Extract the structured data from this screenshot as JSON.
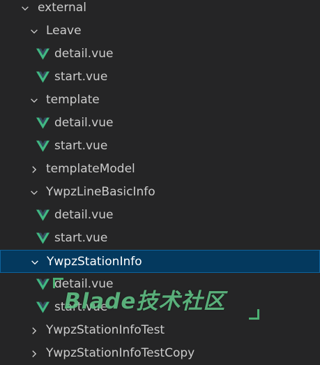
{
  "colors": {
    "background": "#252526",
    "text": "#cccccc",
    "selected_background": "#04395e",
    "selected_border": "#0e639c",
    "vue_green": "#41b883",
    "vue_dark": "#35495e",
    "watermark": "#5fbf84"
  },
  "explorer": {
    "items": [
      {
        "label": "external",
        "type": "folder",
        "expanded": true,
        "icon": "chevron-down-icon"
      },
      {
        "label": "Leave",
        "type": "folder",
        "expanded": true,
        "icon": "chevron-down-icon"
      },
      {
        "label": "detail.vue",
        "type": "file",
        "icon": "vue-file-icon"
      },
      {
        "label": "start.vue",
        "type": "file",
        "icon": "vue-file-icon"
      },
      {
        "label": "template",
        "type": "folder",
        "expanded": true,
        "icon": "chevron-down-icon"
      },
      {
        "label": "detail.vue",
        "type": "file",
        "icon": "vue-file-icon"
      },
      {
        "label": "start.vue",
        "type": "file",
        "icon": "vue-file-icon"
      },
      {
        "label": "templateModel",
        "type": "folder",
        "expanded": false,
        "icon": "chevron-right-icon"
      },
      {
        "label": "YwpzLineBasicInfo",
        "type": "folder",
        "expanded": true,
        "icon": "chevron-down-icon"
      },
      {
        "label": "detail.vue",
        "type": "file",
        "icon": "vue-file-icon"
      },
      {
        "label": "start.vue",
        "type": "file",
        "icon": "vue-file-icon"
      },
      {
        "label": "YwpzStationInfo",
        "type": "folder",
        "expanded": true,
        "selected": true,
        "icon": "chevron-down-icon"
      },
      {
        "label": "detail.vue",
        "type": "file",
        "icon": "vue-file-icon"
      },
      {
        "label": "start.vue",
        "type": "file",
        "icon": "vue-file-icon"
      },
      {
        "label": "YwpzStationInfoTest",
        "type": "folder",
        "expanded": false,
        "icon": "chevron-right-icon"
      },
      {
        "label": "YwpzStationInfoTestCopy",
        "type": "folder",
        "expanded": false,
        "icon": "chevron-right-icon"
      }
    ]
  },
  "watermark": {
    "text": "Blade技术社区"
  }
}
